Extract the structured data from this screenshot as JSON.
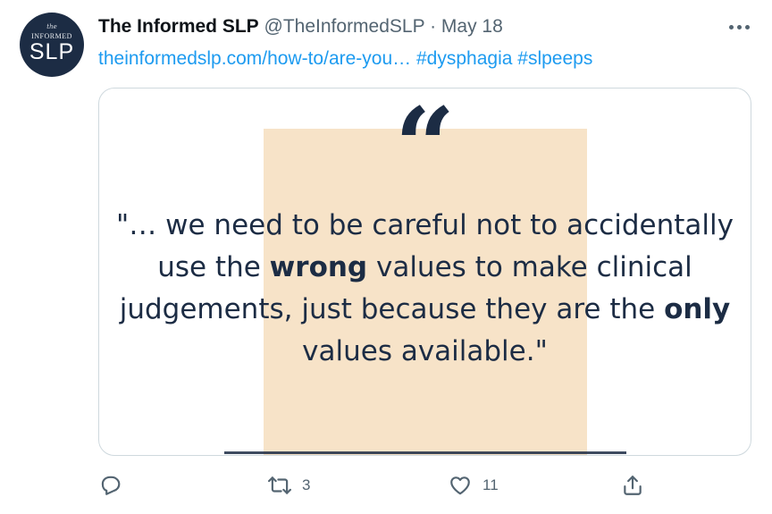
{
  "avatar": {
    "line1": "the",
    "line2": "INFORMED",
    "line3": "SLP"
  },
  "header": {
    "name": "The Informed SLP",
    "handle": "@TheInformedSLP",
    "separator": "·",
    "date": "May 18"
  },
  "tweet": {
    "link": "theinformedslp.com/how-to/are-you…",
    "hashtags": [
      "#dysphagia",
      "#slpeeps"
    ]
  },
  "card": {
    "quote_mark": "“",
    "quote_pre": "\"… we need to be careful not to accidentally use the ",
    "emph1": "wrong",
    "quote_mid": " values to make clinical judgements, just because they are the ",
    "emph2": "only",
    "quote_post": " values available.\""
  },
  "actions": {
    "reply_count": "",
    "retweet_count": "3",
    "like_count": "11"
  },
  "colors": {
    "accent": "#1d9bf0",
    "navy": "#1c2c44",
    "beige": "#f7e3c8",
    "muted": "#536471"
  }
}
